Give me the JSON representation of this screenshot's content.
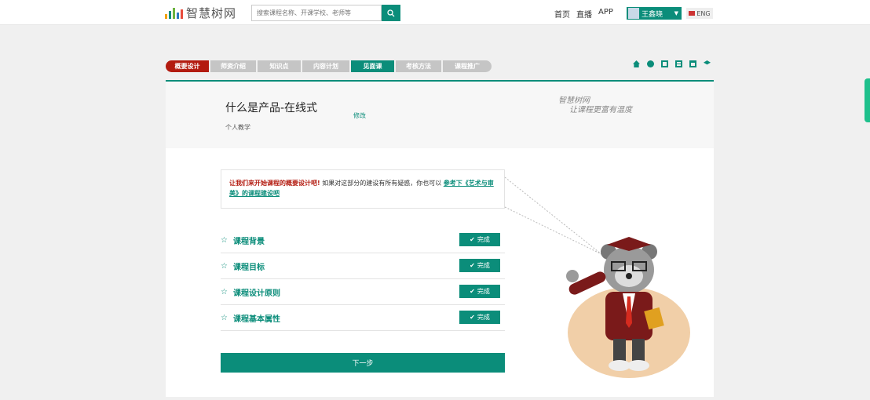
{
  "header": {
    "logo_text": "智慧树网",
    "logo_colors": [
      "#f2a100",
      "#0b8d7a",
      "#6cb33f",
      "#2a7bc0",
      "#e84c3d"
    ],
    "search_placeholder": "搜索课程名称、开课学校、老师等",
    "search_icon": "search-icon",
    "nav": [
      "首页",
      "直播",
      "APP"
    ],
    "user_name": "王鑫晓",
    "lang": "ENG"
  },
  "steps": [
    {
      "label": "概要设计",
      "state": "first"
    },
    {
      "label": "师资介绍",
      "state": ""
    },
    {
      "label": "知识点",
      "state": ""
    },
    {
      "label": "内容计划",
      "state": ""
    },
    {
      "label": "见面课",
      "state": "current"
    },
    {
      "label": "考核方法",
      "state": ""
    },
    {
      "label": "课程推广",
      "state": "last"
    }
  ],
  "step_icons": [
    "home-icon",
    "eye-icon",
    "image-icon",
    "table-icon",
    "window-icon",
    "layers-icon"
  ],
  "course": {
    "title": "什么是产品-在线式",
    "type": "个人教学",
    "edit": "修改",
    "slogan_line1": "智慧树网",
    "slogan_line2": "让课程更富有温度"
  },
  "tip": {
    "red": "让我们来开始课程的概要设计吧!",
    "text": " 如果对这部分的建设有所有疑惑，你也可以 ",
    "link": "参考下《艺术与审美》的课程建设吧"
  },
  "items": [
    {
      "label": "课程背景",
      "status": "完成"
    },
    {
      "label": "课程目标",
      "status": "完成"
    },
    {
      "label": "课程设计原则",
      "status": "完成"
    },
    {
      "label": "课程基本属性",
      "status": "完成"
    }
  ],
  "star": "☆",
  "next_label": "下一步",
  "colors": {
    "accent": "#0b8d7a",
    "red": "#b31b10"
  }
}
